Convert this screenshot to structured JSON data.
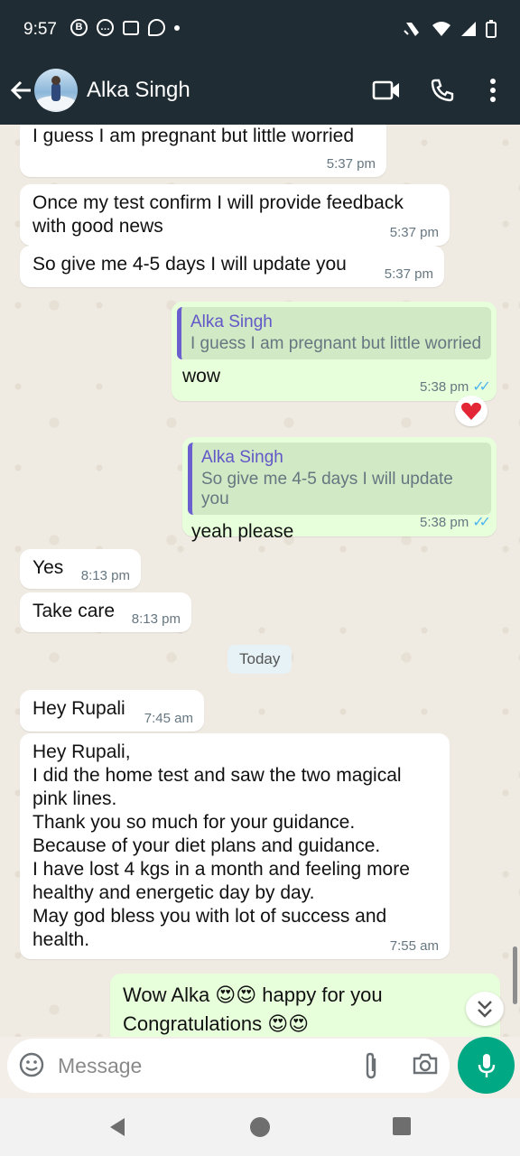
{
  "status_bar": {
    "time": "9:57"
  },
  "header": {
    "contact_name": "Alka Singh"
  },
  "messages": [
    {
      "text": "I guess I am pregnant but little worried",
      "time": "5:37 pm"
    },
    {
      "text": "Once my test confirm I will provide feedback\nwith good news",
      "time": "5:37 pm"
    },
    {
      "text": "So give me 4-5 days I will update you",
      "time": "5:37 pm"
    },
    {
      "quote_name": "Alka Singh",
      "quote_text": "I guess I am pregnant but little worried",
      "text": "wow",
      "time": "5:38 pm",
      "reaction": "❤️"
    },
    {
      "quote_name": "Alka Singh",
      "quote_text": "So give me 4-5 days I will update you",
      "text": "yeah please",
      "time": "5:38 pm"
    },
    {
      "text": "Yes",
      "time": "8:13 pm"
    },
    {
      "text": "Take care",
      "time": "8:13 pm"
    },
    {
      "text": "Hey Rupali",
      "time": "7:45 am"
    },
    {
      "text": "Hey Rupali,\nI did the home test and saw the two magical\npink lines.\nThank you so much for your guidance.\nBecause of your diet plans and guidance.\nI have lost 4 kgs in a month and feeling more\nhealthy and energetic day by day.\nMay god bless you with lot of success and\nhealth.",
      "time": "7:55 am"
    },
    {
      "text": "Wow Alka 😍😍 happy for you\nCongratulations 😍😍"
    }
  ],
  "date_divider": "Today",
  "composer": {
    "placeholder": "Message"
  },
  "colors": {
    "header_bg": "#1f2c33",
    "outgoing_bubble": "#e7ffdb",
    "incoming_bubble": "#ffffff",
    "accent_green": "#00a884",
    "quote_name": "#6257c8",
    "read_ticks": "#4fb6ec"
  },
  "icons": [
    "back-arrow-icon",
    "video-call-icon",
    "phone-icon",
    "more-vertical-icon",
    "heart-icon",
    "double-chevron-down-icon",
    "emoji-icon",
    "attach-icon",
    "camera-icon",
    "mic-icon",
    "nav-back-icon",
    "nav-home-icon",
    "nav-recents-icon"
  ]
}
